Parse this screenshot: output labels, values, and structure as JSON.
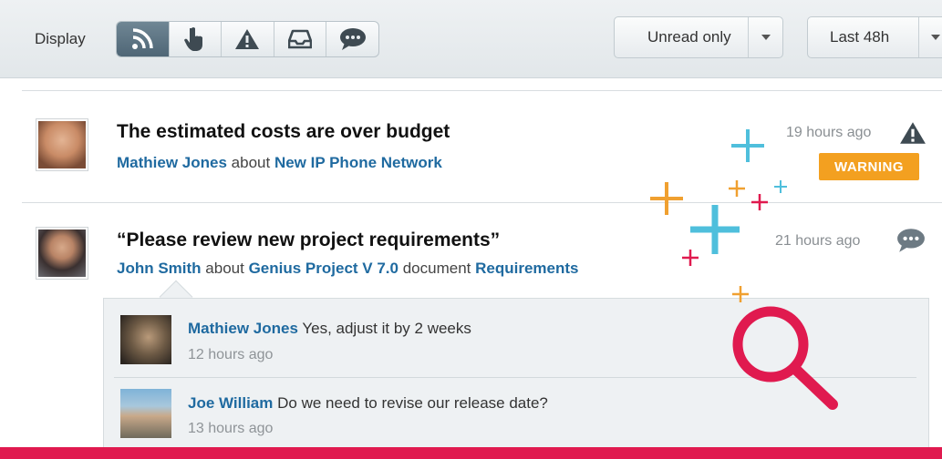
{
  "toolbar": {
    "display_label": "Display",
    "filters": [
      {
        "icon": "rss-icon",
        "active": true
      },
      {
        "icon": "pointer-hand-icon",
        "active": false
      },
      {
        "icon": "warning-icon",
        "active": false
      },
      {
        "icon": "inbox-icon",
        "active": false
      },
      {
        "icon": "comment-icon",
        "active": false
      }
    ],
    "read_filter": "Unread only",
    "time_filter": "Last 48h"
  },
  "feed": [
    {
      "title": "The estimated costs are over budget",
      "author": "Mathiew Jones",
      "about_word": "about",
      "project": "New IP Phone Network",
      "time": "19 hours ago",
      "type_icon": "warning-icon",
      "badge": "WARNING"
    },
    {
      "title": "“Please review new project requirements”",
      "author": "John Smith",
      "about_word": "about",
      "project": "Genius Project V 7.0",
      "document_word": "document",
      "document": "Requirements",
      "time": "21 hours ago",
      "type_icon": "comment-icon",
      "comments": [
        {
          "author": "Mathiew Jones",
          "text": "Yes, adjust it by 2 weeks",
          "time": "12 hours ago"
        },
        {
          "author": "Joe William",
          "text": "Do we need to revise our release date?",
          "time": "13 hours ago"
        }
      ]
    }
  ],
  "colors": {
    "link": "#1f6aa0",
    "warning": "#f3a020",
    "accent_red": "#e01a4f",
    "accent_blue": "#4fbfdc",
    "accent_orange": "#f0a030"
  }
}
